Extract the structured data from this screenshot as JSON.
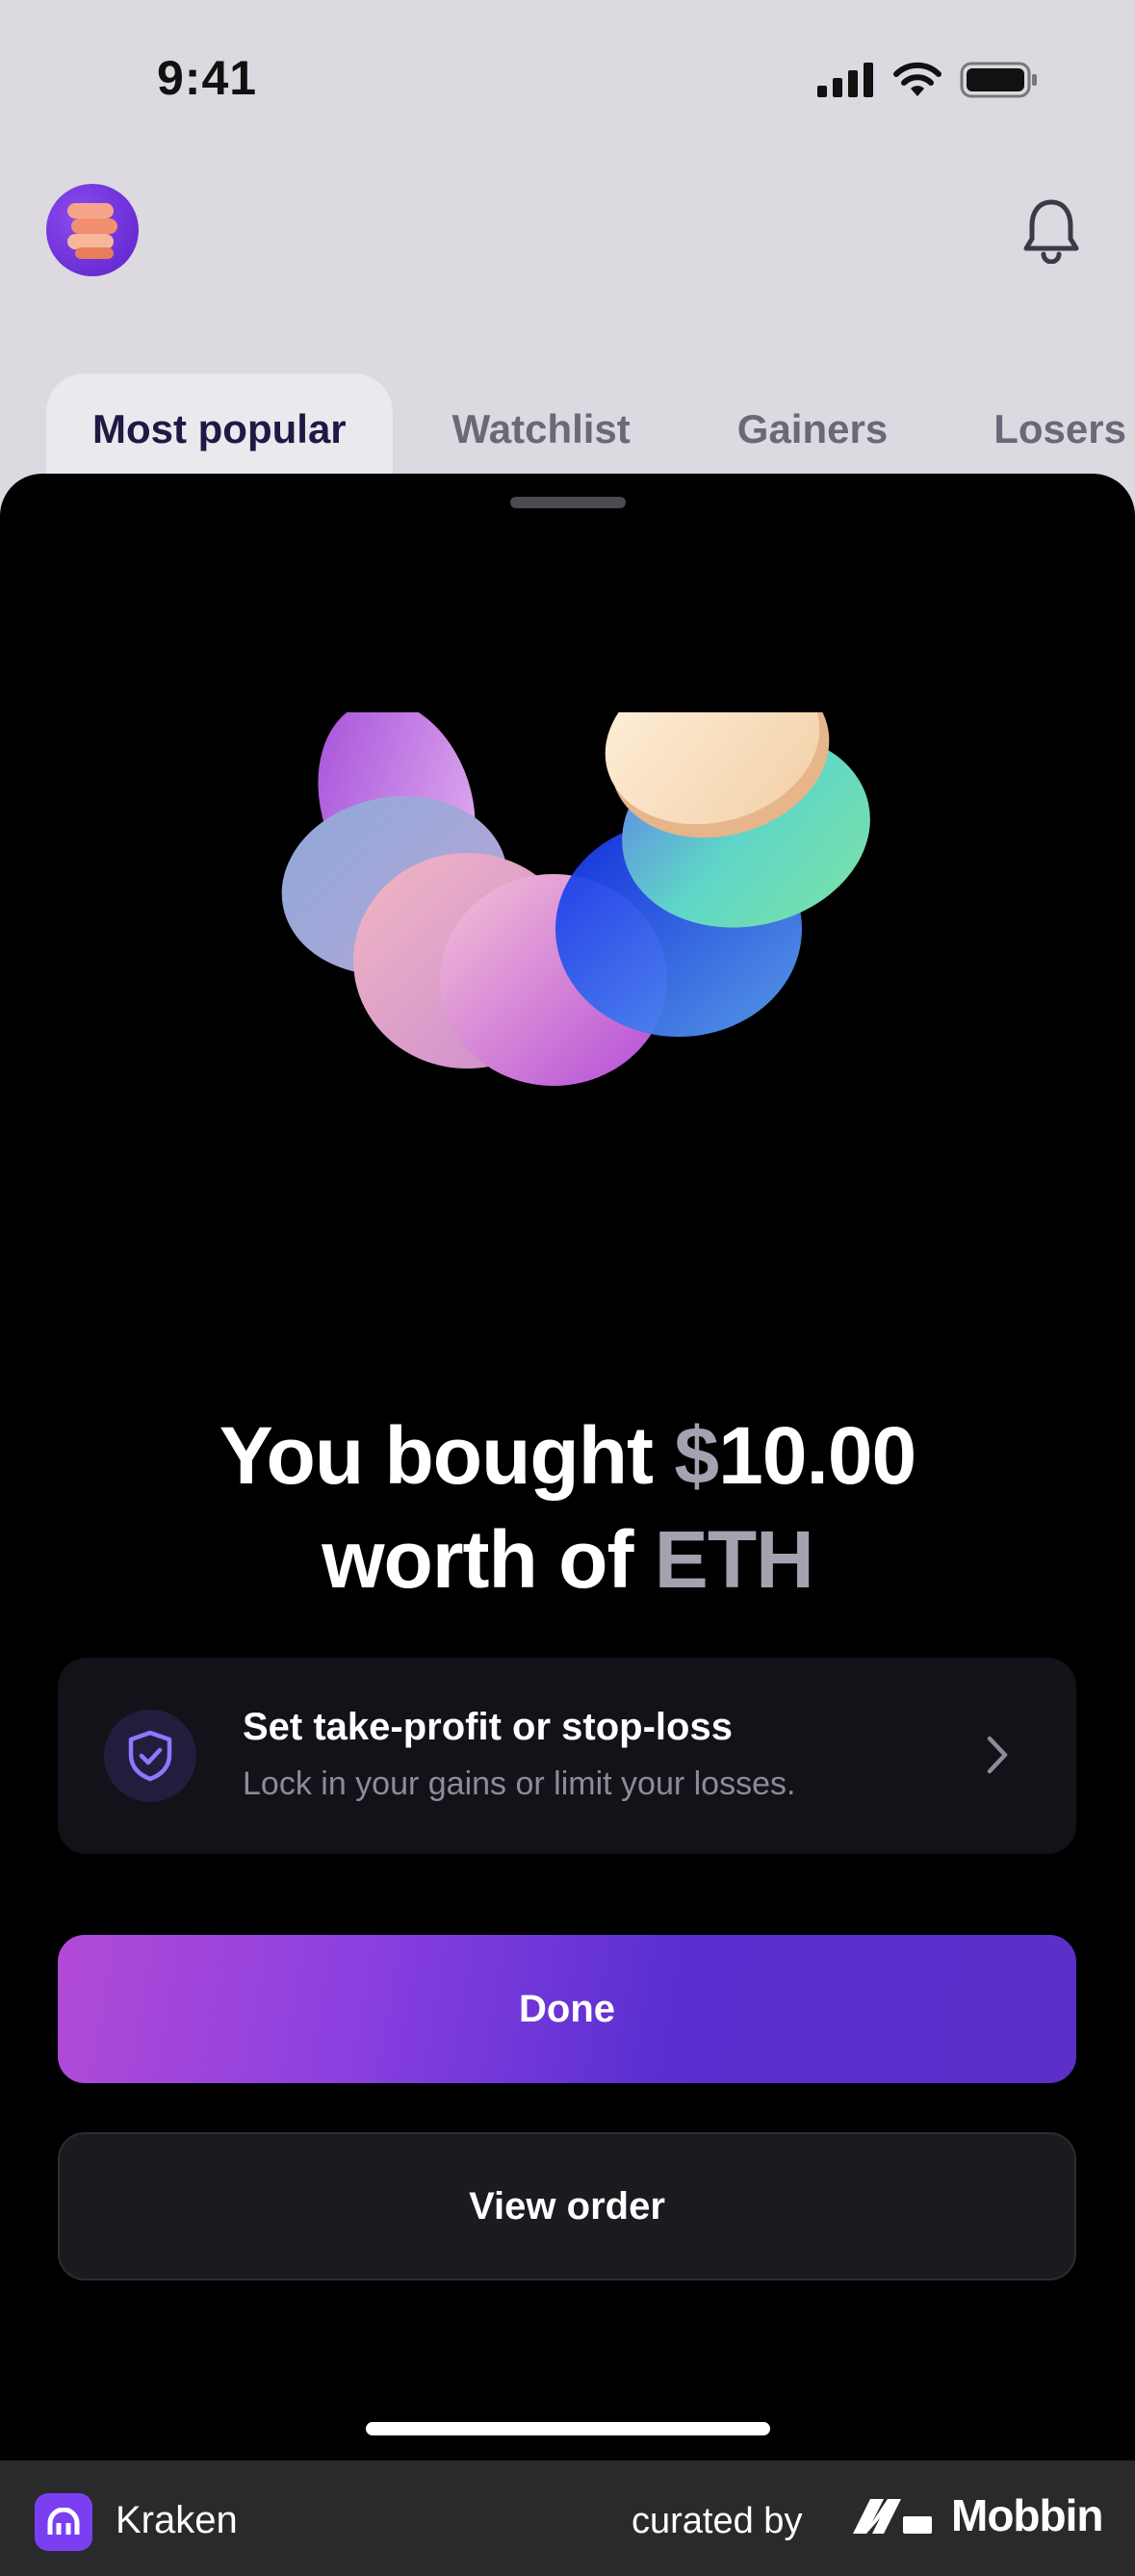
{
  "status_bar": {
    "time": "9:41"
  },
  "header": {
    "avatar_icon": "coins-stack-icon",
    "bell_icon": "bell-icon"
  },
  "tabs": [
    {
      "label": "Most popular",
      "active": true
    },
    {
      "label": "Watchlist"
    },
    {
      "label": "Gainers"
    },
    {
      "label": "Losers"
    }
  ],
  "confirmation": {
    "line1_prefix": "You bought ",
    "currency_symbol": "$",
    "amount": "10.00",
    "line2_prefix": "worth of ",
    "asset": "ETH"
  },
  "card": {
    "title": "Set take-profit or stop-loss",
    "subtitle": "Lock in your gains or limit your losses.",
    "icon": "shield-check-icon"
  },
  "buttons": {
    "done": "Done",
    "view_order": "View order"
  },
  "footer": {
    "app_name": "Kraken",
    "curated_by": "curated by",
    "brand": "Mobbin"
  },
  "colors": {
    "accent": "#5b2fc8",
    "accent_start": "#b24bd6",
    "sheet": "#000000",
    "muted": "#a4a1b0"
  }
}
